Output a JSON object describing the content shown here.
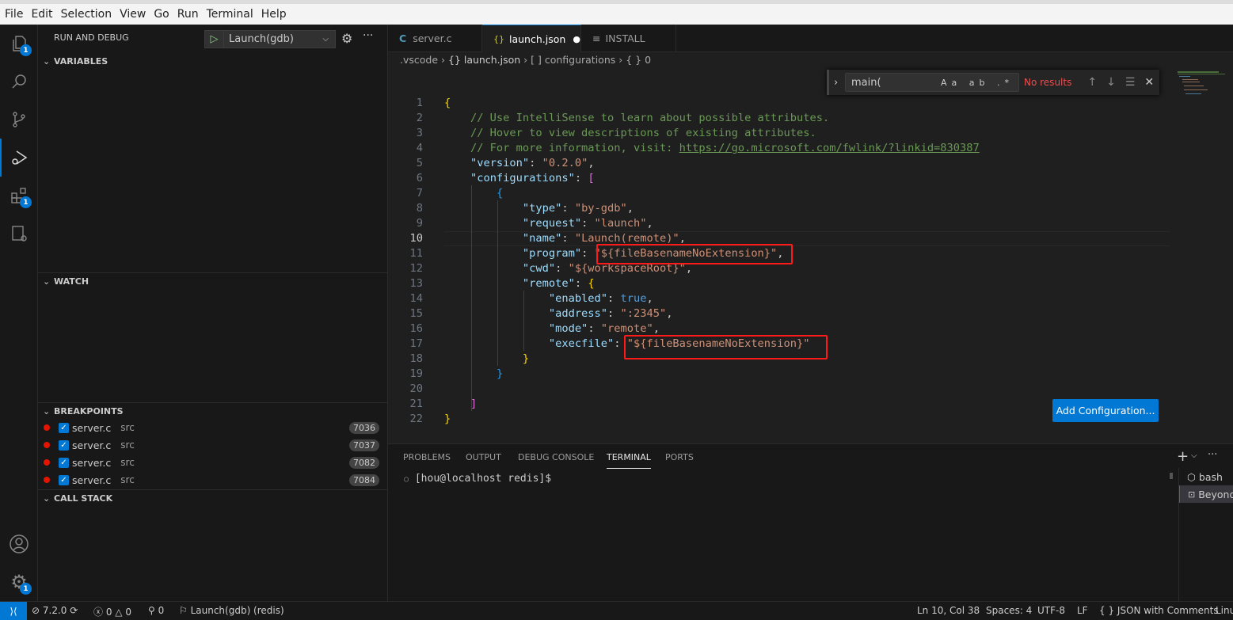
{
  "menu": [
    "File",
    "Edit",
    "Selection",
    "View",
    "Go",
    "Run",
    "Terminal",
    "Help"
  ],
  "activity": {
    "explorer_badge": "1",
    "extensions_badge": "1",
    "settings_badge": "1"
  },
  "sidebar": {
    "title": "RUN AND DEBUG",
    "launch_config": "Launch(gdb)",
    "sections": {
      "variables": "VARIABLES",
      "watch": "WATCH",
      "breakpoints": "BREAKPOINTS",
      "call_stack": "CALL STACK"
    },
    "breakpoints": [
      {
        "file": "server.c",
        "dir": "src",
        "line": "7036"
      },
      {
        "file": "server.c",
        "dir": "src",
        "line": "7037"
      },
      {
        "file": "server.c",
        "dir": "src",
        "line": "7082"
      },
      {
        "file": "server.c",
        "dir": "src",
        "line": "7084"
      }
    ]
  },
  "tabs": [
    {
      "icon": "C",
      "label": "server.c"
    },
    {
      "icon": "{}",
      "label": "launch.json",
      "dirty": "●"
    },
    {
      "icon": "≡",
      "label": "INSTALL"
    }
  ],
  "breadcrumb": [
    ".vscode",
    "{} launch.json",
    "[ ] configurations",
    "{ } 0"
  ],
  "find": {
    "value": "main(",
    "options": "Aa ab .*",
    "status": "No results"
  },
  "editor": {
    "lines": [
      [
        [
          "y",
          "{"
        ]
      ],
      [
        [
          "c",
          "    // Use IntelliSense to learn about possible attributes."
        ]
      ],
      [
        [
          "c",
          "    // Hover to view descriptions of existing attributes."
        ]
      ],
      [
        [
          "c",
          "    // For more information, visit: "
        ],
        [
          "u",
          "https://go.microsoft.com/fwlink/?linkid=830387"
        ]
      ],
      [
        [
          "",
          "    "
        ],
        [
          "k",
          "\"version\""
        ],
        [
          "",
          ": "
        ],
        [
          "s",
          "\"0.2.0\""
        ],
        [
          "",
          ","
        ]
      ],
      [
        [
          "",
          "    "
        ],
        [
          "k",
          "\"configurations\""
        ],
        [
          "",
          ": "
        ],
        [
          "p",
          "["
        ]
      ],
      [
        [
          "",
          "        "
        ],
        [
          "b",
          "{"
        ]
      ],
      [
        [
          "",
          "            "
        ],
        [
          "k",
          "\"type\""
        ],
        [
          "",
          ": "
        ],
        [
          "s",
          "\"by-gdb\""
        ],
        [
          "",
          ","
        ]
      ],
      [
        [
          "",
          "            "
        ],
        [
          "k",
          "\"request\""
        ],
        [
          "",
          ": "
        ],
        [
          "s",
          "\"launch\""
        ],
        [
          "",
          ","
        ]
      ],
      [
        [
          "",
          "            "
        ],
        [
          "k",
          "\"name\""
        ],
        [
          "",
          ": "
        ],
        [
          "s",
          "\"Launch(remote)\""
        ],
        [
          "",
          ","
        ]
      ],
      [
        [
          "",
          "            "
        ],
        [
          "k",
          "\"program\""
        ],
        [
          "",
          ": "
        ],
        [
          "s",
          "\"${fileBasenameNoExtension}\""
        ],
        [
          "",
          ","
        ]
      ],
      [
        [
          "",
          "            "
        ],
        [
          "k",
          "\"cwd\""
        ],
        [
          "",
          ": "
        ],
        [
          "s",
          "\"${workspaceRoot}\""
        ],
        [
          "",
          ","
        ]
      ],
      [
        [
          "",
          "            "
        ],
        [
          "k",
          "\"remote\""
        ],
        [
          "",
          ": "
        ],
        [
          "y",
          "{"
        ]
      ],
      [
        [
          "",
          "                "
        ],
        [
          "k",
          "\"enabled\""
        ],
        [
          "",
          ": "
        ],
        [
          "t",
          "true"
        ],
        [
          "",
          ","
        ]
      ],
      [
        [
          "",
          "                "
        ],
        [
          "k",
          "\"address\""
        ],
        [
          "",
          ": "
        ],
        [
          "s",
          "\":2345\""
        ],
        [
          "",
          ","
        ]
      ],
      [
        [
          "",
          "                "
        ],
        [
          "k",
          "\"mode\""
        ],
        [
          "",
          ": "
        ],
        [
          "s",
          "\"remote\""
        ],
        [
          "",
          ","
        ]
      ],
      [
        [
          "",
          "                "
        ],
        [
          "k",
          "\"execfile\""
        ],
        [
          "",
          ": "
        ],
        [
          "s",
          "\"${fileBasenameNoExtension}\""
        ]
      ],
      [
        [
          "",
          "            "
        ],
        [
          "y",
          "}"
        ]
      ],
      [
        [
          "",
          "        "
        ],
        [
          "b",
          "}"
        ]
      ],
      [
        [
          "",
          ""
        ]
      ],
      [
        [
          "",
          "    "
        ],
        [
          "p",
          "]"
        ]
      ],
      [
        [
          "y",
          "}"
        ]
      ]
    ],
    "current_line": 10,
    "add_config": "Add Configuration..."
  },
  "panel": {
    "tabs": [
      "PROBLEMS",
      "OUTPUT",
      "DEBUG CONSOLE",
      "TERMINAL",
      "PORTS"
    ],
    "active": "TERMINAL",
    "prompt": "[hou@localhost redis]$",
    "terminals": [
      "bash",
      "Beyond"
    ]
  },
  "status": {
    "version": "7.2.0",
    "errors": "0",
    "warnings": "0",
    "ports": "0",
    "debug": "Launch(gdb) (redis)",
    "position": "Ln 10, Col 38",
    "spaces": "Spaces: 4",
    "encoding": "UTF-8",
    "eol": "LF",
    "language": "JSON with Comments",
    "os": "Linu"
  }
}
